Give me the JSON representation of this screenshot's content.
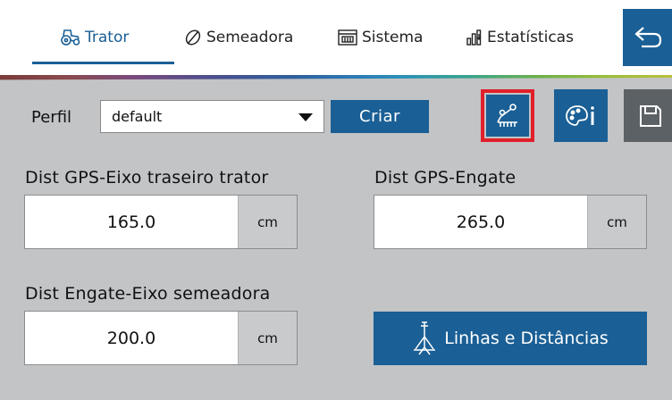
{
  "tabs": [
    {
      "label": "Trator",
      "icon": "tractor-icon",
      "active": true
    },
    {
      "label": "Semeadora",
      "icon": "seed-icon",
      "active": false
    },
    {
      "label": "Sistema",
      "icon": "system-panel-icon",
      "active": false
    },
    {
      "label": "Estatísticas",
      "icon": "statistics-icon",
      "active": false
    }
  ],
  "back_icon": "back-arrow-icon",
  "profile": {
    "label": "Perfil",
    "selected": "default",
    "create_label": "Criar"
  },
  "toolbar_icons": [
    "implement-config-icon",
    "palette-info-icon",
    "save-icon"
  ],
  "fields": {
    "gps_rear_axle": {
      "label": "Dist GPS-Eixo traseiro trator",
      "value": "165.0",
      "unit": "cm"
    },
    "gps_hitch": {
      "label": "Dist GPS-Engate",
      "value": "265.0",
      "unit": "cm"
    },
    "hitch_seeder_axle": {
      "label": "Dist Engate-Eixo semeadora",
      "value": "200.0",
      "unit": "cm"
    }
  },
  "lines_button": {
    "label": "Linhas e Distâncias",
    "icon": "planter-icon"
  },
  "colors": {
    "accent": "#1a5f95",
    "background": "#c2c4c6",
    "highlight": "#e0202a",
    "save": "#5c6166"
  }
}
